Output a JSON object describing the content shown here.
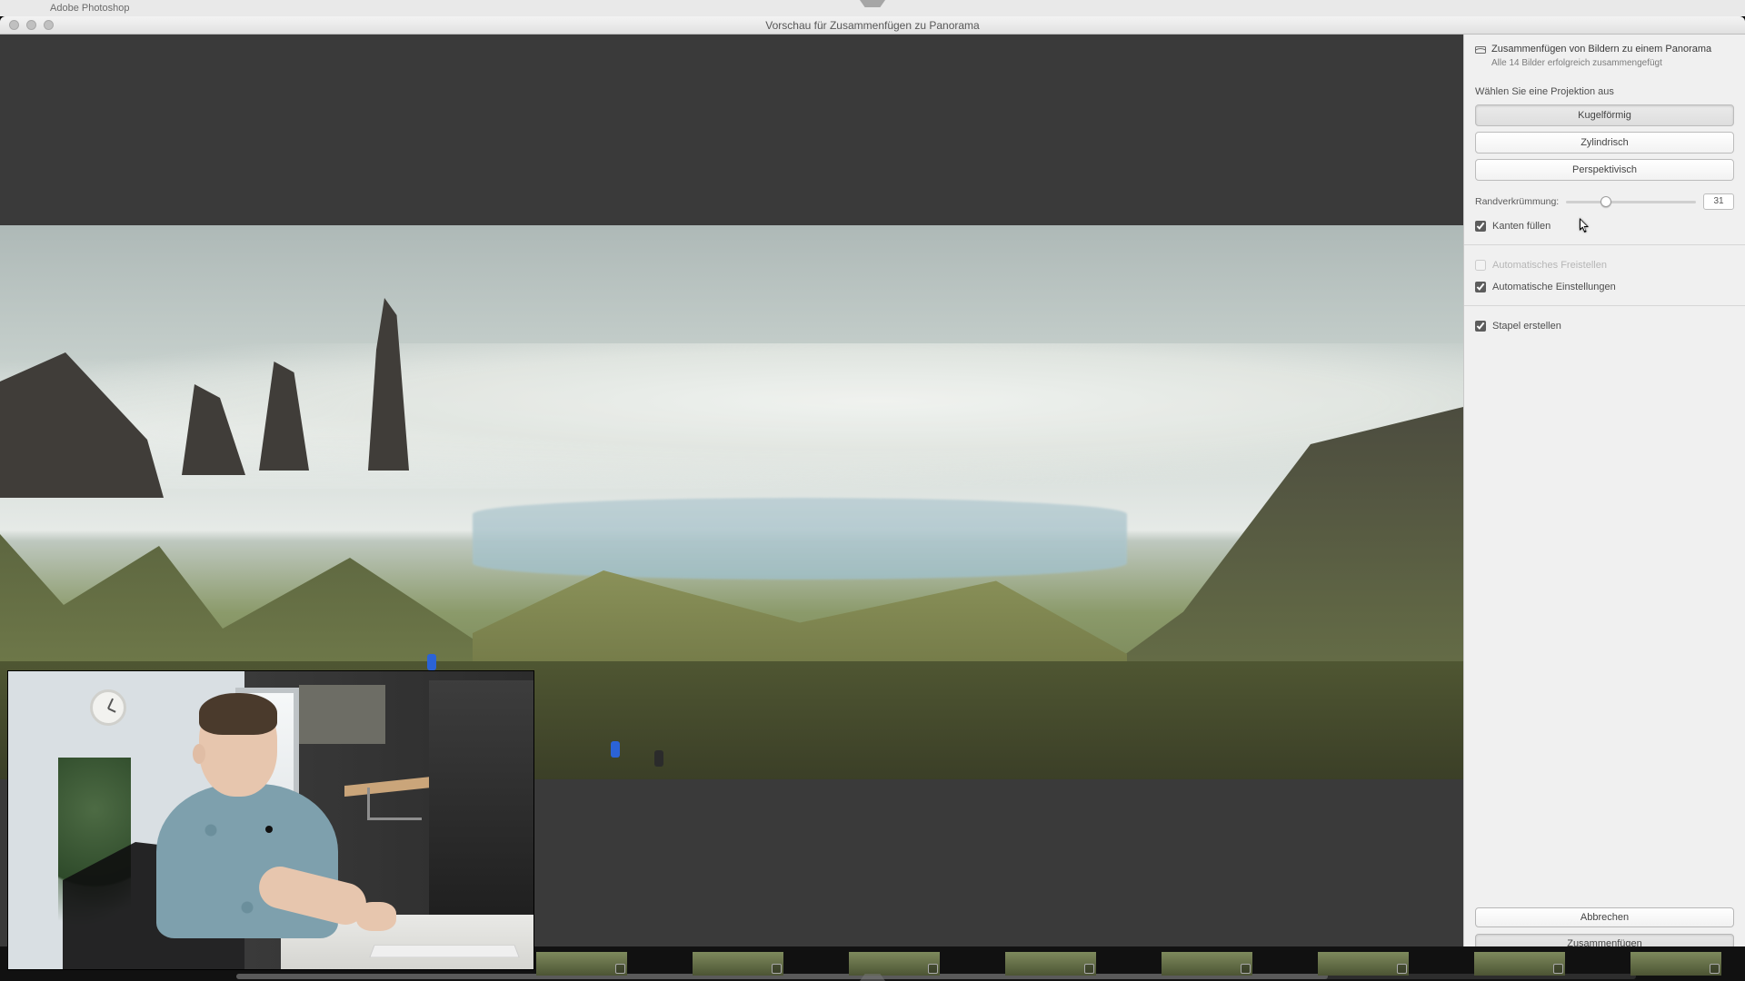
{
  "menu": {
    "app_name": "Adobe Photoshop"
  },
  "window": {
    "title": "Vorschau für Zusammenfügen zu Panorama"
  },
  "panel": {
    "title": "Zusammenfügen von Bildern zu einem Panorama",
    "subtitle": "Alle 14 Bilder erfolgreich zusammengefügt",
    "choose_projection": "Wählen Sie eine Projektion aus",
    "projection": {
      "spherical": "Kugelförmig",
      "cylindrical": "Zylindrisch",
      "perspective": "Perspektivisch"
    },
    "distortion": {
      "label": "Randverkrümmung:",
      "value": "31",
      "percent": 31
    },
    "fill_edges": {
      "label": "Kanten füllen",
      "checked": true
    },
    "auto_crop": {
      "label": "Automatisches Freistellen",
      "checked": false
    },
    "auto_settings": {
      "label": "Automatische Einstellungen",
      "checked": true
    },
    "create_stack": {
      "label": "Stapel erstellen",
      "checked": true
    }
  },
  "buttons": {
    "cancel": "Abbrechen",
    "merge": "Zusammenfügen"
  },
  "thumbnails": {
    "count": 8
  }
}
